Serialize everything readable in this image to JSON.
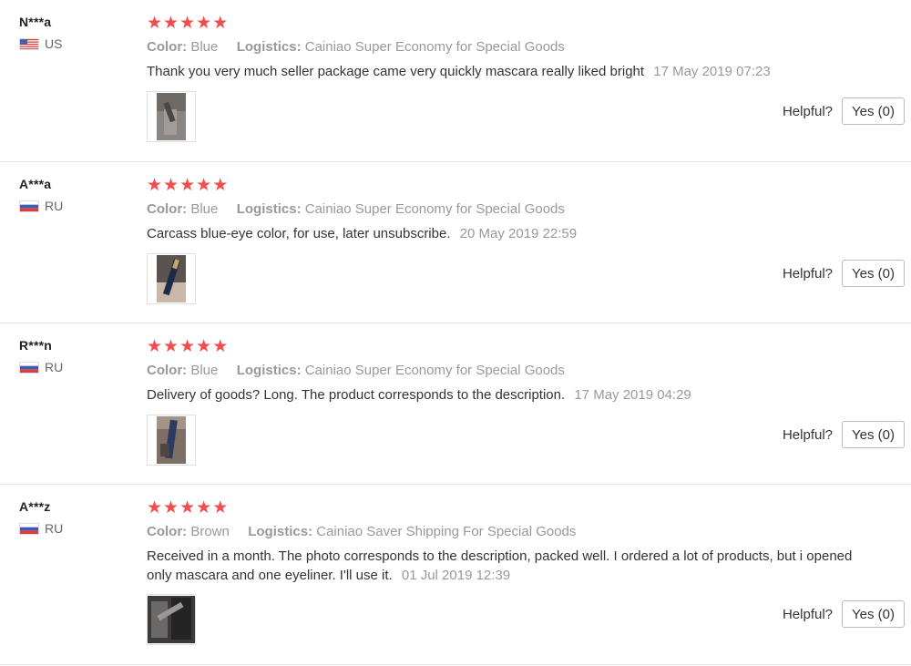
{
  "reviews": [
    {
      "user": "N***a",
      "country": "US",
      "flag_icon": "us-flag-icon",
      "rating": 5,
      "color_label": "Color:",
      "color_value": "Blue",
      "logistics_label": "Logistics:",
      "logistics_value": "Cainiao Super Economy for Special Goods",
      "text": "Thank you very much seller package came very quickly mascara really liked bright",
      "date": "17 May 2019 07:23",
      "helpful_label": "Helpful?",
      "yes_label": "Yes (0)"
    },
    {
      "user": "A***a",
      "country": "RU",
      "flag_icon": "ru-flag-icon",
      "rating": 5,
      "color_label": "Color:",
      "color_value": "Blue",
      "logistics_label": "Logistics:",
      "logistics_value": "Cainiao Super Economy for Special Goods",
      "text": "Carcass blue-eye color, for use, later unsubscribe.",
      "date": "20 May 2019 22:59",
      "helpful_label": "Helpful?",
      "yes_label": "Yes (0)"
    },
    {
      "user": "R***n",
      "country": "RU",
      "flag_icon": "ru-flag-icon",
      "rating": 5,
      "color_label": "Color:",
      "color_value": "Blue",
      "logistics_label": "Logistics:",
      "logistics_value": "Cainiao Super Economy for Special Goods",
      "text": "Delivery of goods? Long. The product corresponds to the description.",
      "date": "17 May 2019 04:29",
      "helpful_label": "Helpful?",
      "yes_label": "Yes (0)"
    },
    {
      "user": "A***z",
      "country": "RU",
      "flag_icon": "ru-flag-icon",
      "rating": 5,
      "color_label": "Color:",
      "color_value": "Brown",
      "logistics_label": "Logistics:",
      "logistics_value": "Cainiao Saver Shipping For Special Goods",
      "text": "Received in a month. The photo corresponds to the description, packed well. I ordered a lot of products, but i opened only mascara and one eyeliner. I'll use it.",
      "date": "01 Jul 2019 12:39",
      "helpful_label": "Helpful?",
      "yes_label": "Yes (0)"
    }
  ],
  "star_icon": "star-icon",
  "colors": {
    "star": "#f04e4e",
    "muted": "#999999",
    "text": "#333333"
  }
}
